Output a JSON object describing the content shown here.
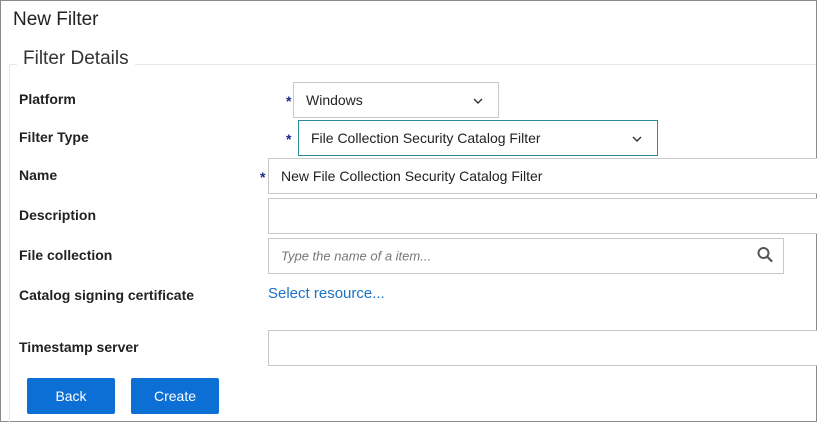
{
  "page": {
    "title": "New Filter"
  },
  "section": {
    "legend": "Filter Details"
  },
  "fields": {
    "platform": {
      "label": "Platform",
      "value": "Windows",
      "required_mark": "*"
    },
    "filter_type": {
      "label": "Filter Type",
      "value": "File Collection Security Catalog Filter",
      "required_mark": "*"
    },
    "name": {
      "label": "Name",
      "value": "New File Collection Security Catalog Filter",
      "required_mark": "*"
    },
    "description": {
      "label": "Description",
      "value": ""
    },
    "file_collection": {
      "label": "File collection",
      "placeholder": "Type the name of a item..."
    },
    "catalog_cert": {
      "label": "Catalog signing certificate",
      "link": "Select resource..."
    },
    "timestamp": {
      "label": "Timestamp server",
      "value": ""
    }
  },
  "buttons": {
    "back": "Back",
    "create": "Create"
  },
  "icons": {
    "dropdown": "chevron-down-icon",
    "search": "search-icon"
  },
  "colors": {
    "primary": "#0b6fd6",
    "link": "#1a73c8",
    "required": "#1a2a8a",
    "focus_border": "#2f8a9a"
  }
}
